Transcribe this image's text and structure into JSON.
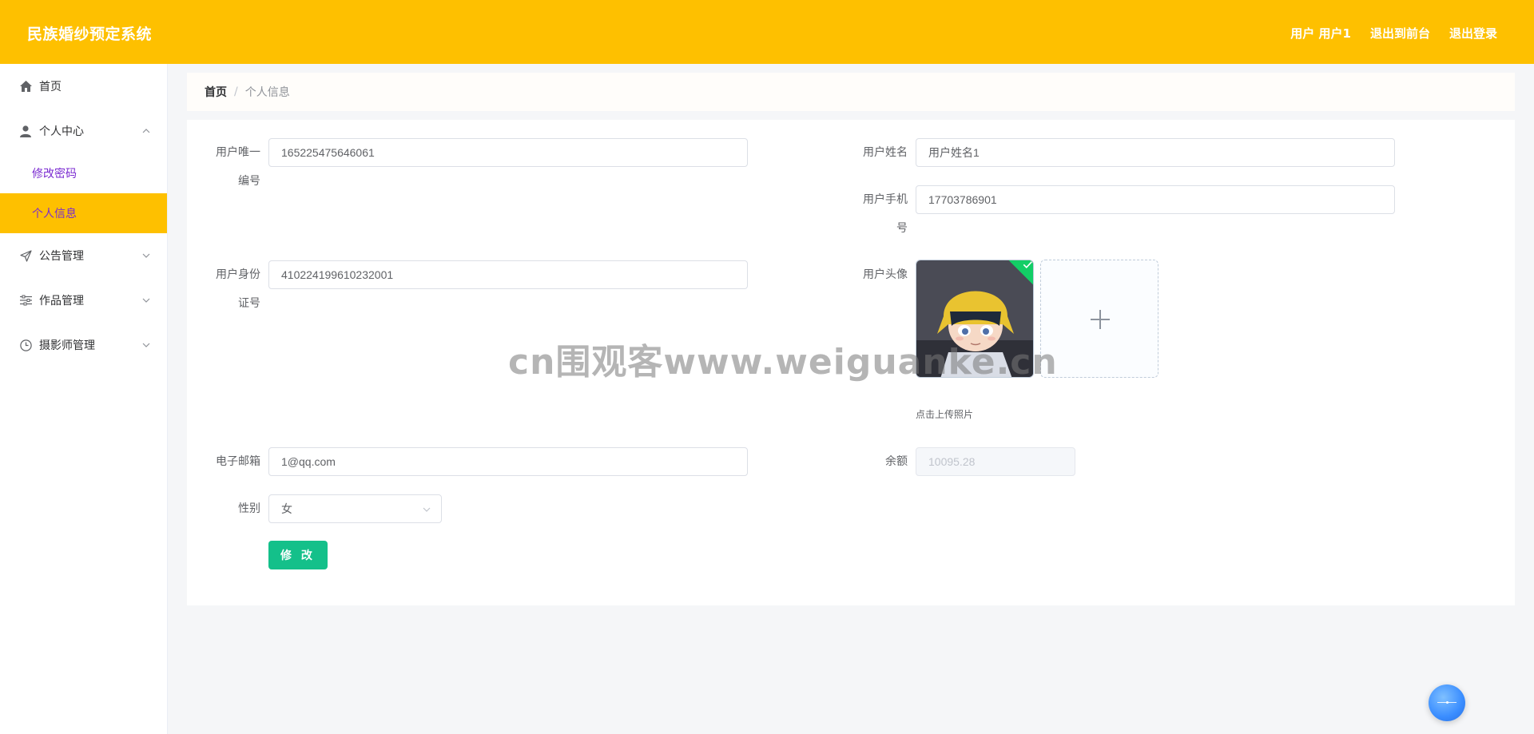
{
  "header": {
    "brand": "民族婚纱预定系统",
    "user_label": "用户 用户1",
    "to_front": "退出到前台",
    "logout": "退出登录"
  },
  "sidebar": {
    "home": "首页",
    "personal_center": "个人中心",
    "change_password": "修改密码",
    "personal_info": "个人信息",
    "notice_mgmt": "公告管理",
    "works_mgmt": "作品管理",
    "photographer_mgmt": "摄影师管理"
  },
  "breadcrumb": {
    "home": "首页",
    "separator": "/",
    "current": "个人信息"
  },
  "form": {
    "user_id_label_1": "用户唯一",
    "user_id_label_2": "编号",
    "user_id_value": "165225475646061",
    "name_label": "用户姓名",
    "name_value": "用户姓名1",
    "phone_label_1": "用户手机",
    "phone_label_2": "号",
    "phone_value": "17703786901",
    "idcard_label_1": "用户身份",
    "idcard_label_2": "证号",
    "idcard_value": "410224199610232001",
    "avatar_label": "用户头像",
    "upload_tip": "点击上传照片",
    "email_label": "电子邮箱",
    "email_value": "1@qq.com",
    "balance_label": "余额",
    "balance_value": "10095.28",
    "gender_label": "性别",
    "gender_value": "女",
    "submit": "修 改"
  },
  "watermark": "cn围观客www.weiguanke.cn",
  "colors": {
    "header_bg": "#fec000",
    "active_menu_bg": "#fec000",
    "submenu_text": "#7b2bd1",
    "submit_bg": "#14c08a",
    "success_badge": "#13ce66"
  }
}
